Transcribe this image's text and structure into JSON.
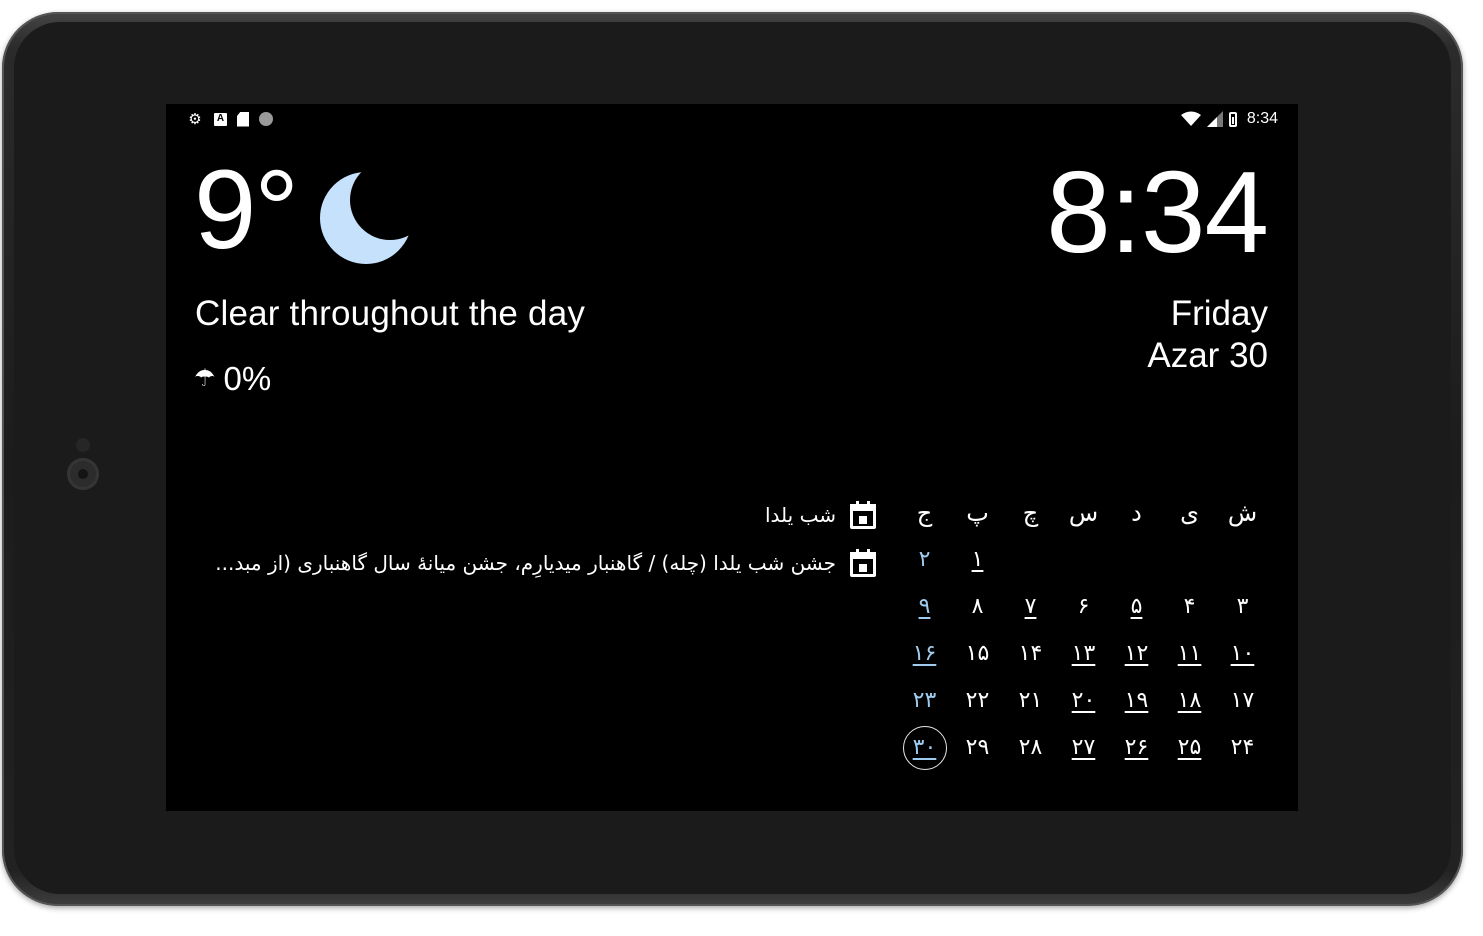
{
  "status_bar": {
    "left_icons": [
      "settings-icon",
      "keyboard-a-icon",
      "sd-card-icon",
      "dot-icon"
    ],
    "right_icons": [
      "wifi-icon",
      "signal-icon",
      "battery-icon"
    ],
    "time": "8:34"
  },
  "weather": {
    "temperature": "9°",
    "condition_icon": "moon-icon",
    "moon_color": "#c6e1fb",
    "summary": "Clear throughout the day",
    "precip_icon": "umbrella-icon",
    "precipitation": "0%"
  },
  "clock": {
    "time": "8:34",
    "day": "Friday",
    "date": "Azar 30"
  },
  "events": [
    {
      "icon": "calendar-icon",
      "text": "شب یلدا"
    },
    {
      "icon": "calendar-icon",
      "text": "جشن شب یلدا (چله) / گاهنبار میدیارِم، جشن میانهٔ سال گاهنباری (از مبد..."
    }
  ],
  "calendar": {
    "accent_color": "#9fcbee",
    "weekdays": [
      "ش",
      "ی",
      "د",
      "س",
      "چ",
      "پ",
      "ج"
    ],
    "weeks": [
      [
        {
          "d": ""
        },
        {
          "d": ""
        },
        {
          "d": ""
        },
        {
          "d": ""
        },
        {
          "d": ""
        },
        {
          "d": "۱",
          "ul": true
        },
        {
          "d": "۲",
          "fri": true
        }
      ],
      [
        {
          "d": "۳"
        },
        {
          "d": "۴"
        },
        {
          "d": "۵",
          "ul": true
        },
        {
          "d": "۶"
        },
        {
          "d": "۷",
          "ul": true
        },
        {
          "d": "۸"
        },
        {
          "d": "۹",
          "fri": true,
          "ul": true
        }
      ],
      [
        {
          "d": "۱۰",
          "ul": true
        },
        {
          "d": "۱۱",
          "ul": true
        },
        {
          "d": "۱۲",
          "ul": true
        },
        {
          "d": "۱۳",
          "ul": true
        },
        {
          "d": "۱۴"
        },
        {
          "d": "۱۵"
        },
        {
          "d": "۱۶",
          "fri": true,
          "ul": true
        }
      ],
      [
        {
          "d": "۱۷"
        },
        {
          "d": "۱۸",
          "ul": true
        },
        {
          "d": "۱۹",
          "ul": true
        },
        {
          "d": "۲۰",
          "ul": true
        },
        {
          "d": "۲۱"
        },
        {
          "d": "۲۲"
        },
        {
          "d": "۲۳",
          "fri": true
        }
      ],
      [
        {
          "d": "۲۴"
        },
        {
          "d": "۲۵",
          "ul": true
        },
        {
          "d": "۲۶",
          "ul": true
        },
        {
          "d": "۲۷",
          "ul": true
        },
        {
          "d": "۲۸"
        },
        {
          "d": "۲۹"
        },
        {
          "d": "۳۰",
          "fri": true,
          "ul": true,
          "today": true
        }
      ]
    ]
  }
}
